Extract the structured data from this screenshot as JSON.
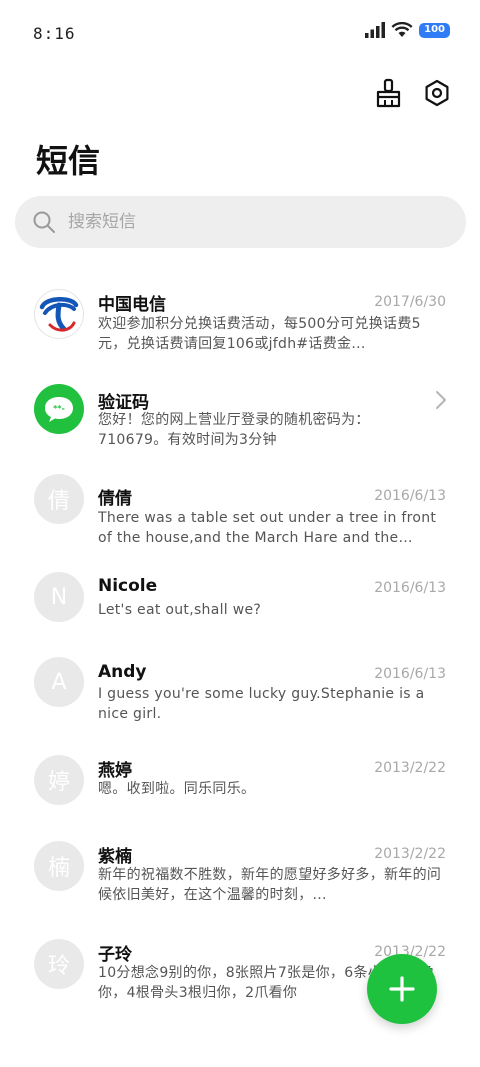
{
  "status": {
    "time": "8:16",
    "battery": "100"
  },
  "header": {
    "title": "短信"
  },
  "search": {
    "placeholder": "搜索短信"
  },
  "threads": [
    {
      "name": "中国电信",
      "date": "2017/6/30",
      "preview": "欢迎参加积分兑换话费活动，每500分可兑换话费5元，兑换话费请回复106或jfdh#话费金...",
      "avatar": "telecom-logo-icon"
    },
    {
      "name": "验证码",
      "date": "",
      "preview": "您好！您的网上营业厅登录的随机密码为：710679。有效时间为3分钟",
      "avatar": "message-bubble-icon"
    },
    {
      "name": "倩倩",
      "date": "2016/6/13",
      "preview": "There was a table set out under a tree in front of the house,and the March Hare and the Hatte...",
      "avatar_text": "倩"
    },
    {
      "name": "Nicole",
      "date": "2016/6/13",
      "preview": "Let's eat out,shall we?",
      "avatar_text": "N"
    },
    {
      "name": "Andy",
      "date": "2016/6/13",
      "preview": "I guess you're some lucky guy.Stephanie is a nice girl.",
      "avatar_text": "A"
    },
    {
      "name": "燕婷",
      "date": "2013/2/22",
      "preview": "嗯。收到啦。同乐同乐。",
      "avatar_text": "婷"
    },
    {
      "name": "紫楠",
      "date": "2013/2/22",
      "preview": "新年的祝福数不胜数，新年的愿望好多好多，新年的问候依旧美好，在这个温馨的时刻，...",
      "avatar_text": "楠"
    },
    {
      "name": "子玲",
      "date": "2013/2/22",
      "preview": "10分想念9别的你，8张照片7张是你，6条小狗5只像你，4根骨头3根归你，2爪看你",
      "avatar_text": "玲"
    }
  ],
  "colors": {
    "accent": "#1fc23e",
    "avatar_gray": "#e9e9e9",
    "battery": "#2f7cf6"
  }
}
